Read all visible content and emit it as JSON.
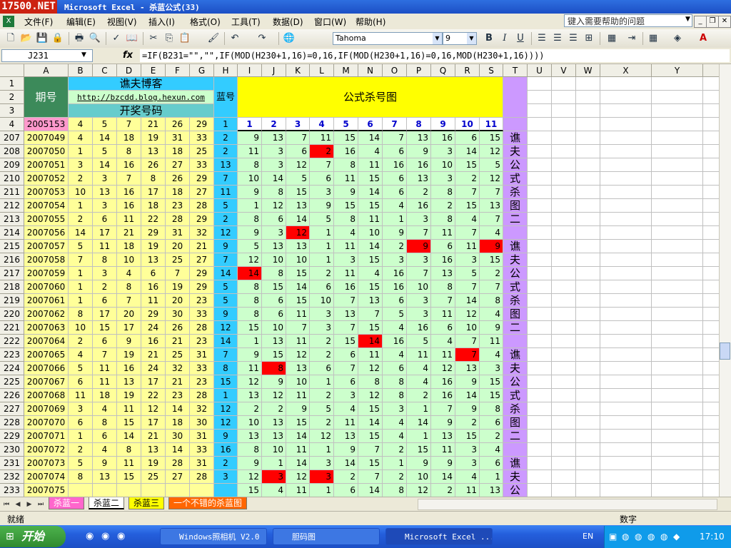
{
  "window": {
    "title": "Microsoft Excel - 杀蓝公式(33)",
    "logo": "17500.NET"
  },
  "menu": [
    "文件(F)",
    "编辑(E)",
    "视图(V)",
    "插入(I)",
    "格式(O)",
    "工具(T)",
    "数据(D)",
    "窗口(W)",
    "帮助(H)"
  ],
  "help_placeholder": "键入需要帮助的问题",
  "toolbar": {
    "font": "Tahoma",
    "size": "9"
  },
  "formula_bar": {
    "name_box": "J231",
    "fx": "fx",
    "formula": "=IF(B231=\"\",\"\",IF(MOD(H230+1,16)=0,16,IF(MOD(H230+1,16)=0,16,MOD(H230+1,16))))"
  },
  "columns": [
    "A",
    "B",
    "C",
    "D",
    "E",
    "F",
    "G",
    "H",
    "I",
    "J",
    "K",
    "L",
    "M",
    "N",
    "O",
    "P",
    "Q",
    "R",
    "S",
    "T",
    "U",
    "V",
    "W",
    "X",
    "Y",
    "Z"
  ],
  "header": {
    "period_label": "期号",
    "blog_label": "谯夫博客",
    "blog_url": "http://bzcdd.blog.hexun.com",
    "draw_label": "开奖号码",
    "blue_label": "蓝号",
    "chart_label": "公式杀号图",
    "header_row_nums": [
      "1",
      "2",
      "3",
      "4"
    ],
    "row4": {
      "period": "2005153",
      "nums": [
        "4",
        "5",
        "7",
        "21",
        "26",
        "29"
      ],
      "blue": "1"
    },
    "kill_headers": [
      "1",
      "2",
      "3",
      "4",
      "5",
      "6",
      "7",
      "8",
      "9",
      "10",
      "11"
    ]
  },
  "rows": [
    {
      "r": "207",
      "p": "2007049",
      "n": [
        "4",
        "14",
        "18",
        "19",
        "31",
        "33"
      ],
      "b": "2",
      "k": [
        "9",
        "13",
        "7",
        "11",
        "15",
        "14",
        "7",
        "13",
        "16",
        "6",
        "15"
      ]
    },
    {
      "r": "208",
      "p": "2007050",
      "n": [
        "1",
        "5",
        "8",
        "13",
        "18",
        "25"
      ],
      "b": "2",
      "k": [
        "11",
        "3",
        "6",
        "2",
        "16",
        "4",
        "6",
        "9",
        "3",
        "14",
        "12"
      ]
    },
    {
      "r": "209",
      "p": "2007051",
      "n": [
        "3",
        "14",
        "16",
        "26",
        "27",
        "33"
      ],
      "b": "13",
      "k": [
        "8",
        "3",
        "12",
        "7",
        "8",
        "11",
        "16",
        "16",
        "10",
        "15",
        "5"
      ]
    },
    {
      "r": "210",
      "p": "2007052",
      "n": [
        "2",
        "3",
        "7",
        "8",
        "26",
        "29"
      ],
      "b": "7",
      "k": [
        "10",
        "14",
        "5",
        "6",
        "11",
        "15",
        "6",
        "13",
        "3",
        "2",
        "12"
      ]
    },
    {
      "r": "211",
      "p": "2007053",
      "n": [
        "10",
        "13",
        "16",
        "17",
        "18",
        "27"
      ],
      "b": "11",
      "k": [
        "9",
        "8",
        "15",
        "3",
        "9",
        "14",
        "6",
        "2",
        "8",
        "7",
        "7"
      ]
    },
    {
      "r": "212",
      "p": "2007054",
      "n": [
        "1",
        "3",
        "16",
        "18",
        "23",
        "28"
      ],
      "b": "5",
      "k": [
        "1",
        "12",
        "13",
        "9",
        "15",
        "15",
        "4",
        "16",
        "2",
        "15",
        "13"
      ]
    },
    {
      "r": "213",
      "p": "2007055",
      "n": [
        "2",
        "6",
        "11",
        "22",
        "28",
        "29"
      ],
      "b": "2",
      "k": [
        "8",
        "6",
        "14",
        "5",
        "8",
        "11",
        "1",
        "3",
        "8",
        "4",
        "7"
      ]
    },
    {
      "r": "214",
      "p": "2007056",
      "n": [
        "14",
        "17",
        "21",
        "29",
        "31",
        "32"
      ],
      "b": "12",
      "k": [
        "9",
        "3",
        "12",
        "1",
        "4",
        "10",
        "9",
        "7",
        "11",
        "7",
        "4"
      ]
    },
    {
      "r": "215",
      "p": "2007057",
      "n": [
        "5",
        "11",
        "18",
        "19",
        "20",
        "21"
      ],
      "b": "9",
      "k": [
        "5",
        "13",
        "13",
        "1",
        "11",
        "14",
        "2",
        "9",
        "6",
        "11",
        "9"
      ]
    },
    {
      "r": "216",
      "p": "2007058",
      "n": [
        "7",
        "8",
        "10",
        "13",
        "25",
        "27"
      ],
      "b": "7",
      "k": [
        "12",
        "10",
        "10",
        "1",
        "3",
        "15",
        "3",
        "3",
        "16",
        "3",
        "15"
      ]
    },
    {
      "r": "217",
      "p": "2007059",
      "n": [
        "1",
        "3",
        "4",
        "6",
        "7",
        "29"
      ],
      "b": "14",
      "k": [
        "14",
        "8",
        "15",
        "2",
        "11",
        "4",
        "16",
        "7",
        "13",
        "5",
        "2"
      ]
    },
    {
      "r": "218",
      "p": "2007060",
      "n": [
        "1",
        "2",
        "8",
        "16",
        "19",
        "29"
      ],
      "b": "5",
      "k": [
        "8",
        "15",
        "14",
        "6",
        "16",
        "15",
        "16",
        "10",
        "8",
        "7",
        "7"
      ]
    },
    {
      "r": "219",
      "p": "2007061",
      "n": [
        "1",
        "6",
        "7",
        "11",
        "20",
        "23"
      ],
      "b": "5",
      "k": [
        "8",
        "6",
        "15",
        "10",
        "7",
        "13",
        "6",
        "3",
        "7",
        "14",
        "8"
      ]
    },
    {
      "r": "220",
      "p": "2007062",
      "n": [
        "8",
        "17",
        "20",
        "29",
        "30",
        "33"
      ],
      "b": "9",
      "k": [
        "8",
        "6",
        "11",
        "3",
        "13",
        "7",
        "5",
        "3",
        "11",
        "12",
        "4"
      ]
    },
    {
      "r": "221",
      "p": "2007063",
      "n": [
        "10",
        "15",
        "17",
        "24",
        "26",
        "28"
      ],
      "b": "12",
      "k": [
        "15",
        "10",
        "7",
        "3",
        "7",
        "15",
        "4",
        "16",
        "6",
        "10",
        "9"
      ]
    },
    {
      "r": "222",
      "p": "2007064",
      "n": [
        "2",
        "6",
        "9",
        "16",
        "21",
        "23"
      ],
      "b": "14",
      "k": [
        "1",
        "13",
        "11",
        "2",
        "15",
        "14",
        "16",
        "5",
        "4",
        "7",
        "11"
      ]
    },
    {
      "r": "223",
      "p": "2007065",
      "n": [
        "4",
        "7",
        "19",
        "21",
        "25",
        "31"
      ],
      "b": "7",
      "k": [
        "9",
        "15",
        "12",
        "2",
        "6",
        "11",
        "4",
        "11",
        "11",
        "7",
        "4"
      ]
    },
    {
      "r": "224",
      "p": "2007066",
      "n": [
        "5",
        "11",
        "16",
        "24",
        "32",
        "33"
      ],
      "b": "8",
      "k": [
        "11",
        "8",
        "13",
        "6",
        "7",
        "12",
        "6",
        "4",
        "12",
        "13",
        "3"
      ]
    },
    {
      "r": "225",
      "p": "2007067",
      "n": [
        "6",
        "11",
        "13",
        "17",
        "21",
        "23"
      ],
      "b": "15",
      "k": [
        "12",
        "9",
        "10",
        "1",
        "6",
        "8",
        "8",
        "4",
        "16",
        "9",
        "15"
      ]
    },
    {
      "r": "226",
      "p": "2007068",
      "n": [
        "11",
        "18",
        "19",
        "22",
        "23",
        "28"
      ],
      "b": "1",
      "k": [
        "13",
        "12",
        "11",
        "2",
        "3",
        "12",
        "8",
        "2",
        "16",
        "14",
        "15"
      ]
    },
    {
      "r": "227",
      "p": "2007069",
      "n": [
        "3",
        "4",
        "11",
        "12",
        "14",
        "32"
      ],
      "b": "12",
      "k": [
        "2",
        "2",
        "9",
        "5",
        "4",
        "15",
        "3",
        "1",
        "7",
        "9",
        "8"
      ]
    },
    {
      "r": "228",
      "p": "2007070",
      "n": [
        "6",
        "8",
        "15",
        "17",
        "18",
        "30"
      ],
      "b": "12",
      "k": [
        "10",
        "13",
        "15",
        "2",
        "11",
        "14",
        "4",
        "14",
        "9",
        "2",
        "6"
      ]
    },
    {
      "r": "229",
      "p": "2007071",
      "n": [
        "1",
        "6",
        "14",
        "21",
        "30",
        "31"
      ],
      "b": "9",
      "k": [
        "13",
        "13",
        "14",
        "12",
        "13",
        "15",
        "4",
        "1",
        "13",
        "15",
        "2"
      ]
    },
    {
      "r": "230",
      "p": "2007072",
      "n": [
        "2",
        "4",
        "8",
        "13",
        "14",
        "33"
      ],
      "b": "16",
      "k": [
        "8",
        "10",
        "11",
        "1",
        "9",
        "7",
        "2",
        "15",
        "11",
        "3",
        "4"
      ]
    },
    {
      "r": "231",
      "p": "2007073",
      "n": [
        "5",
        "9",
        "11",
        "19",
        "28",
        "31"
      ],
      "b": "2",
      "k": [
        "9",
        "1",
        "14",
        "3",
        "14",
        "15",
        "1",
        "9",
        "9",
        "3",
        "6"
      ]
    },
    {
      "r": "232",
      "p": "2007074",
      "n": [
        "8",
        "13",
        "15",
        "25",
        "27",
        "28"
      ],
      "b": "3",
      "k": [
        "12",
        "3",
        "12",
        "3",
        "2",
        "7",
        "2",
        "10",
        "14",
        "4",
        "1"
      ]
    },
    {
      "r": "233",
      "p": "2007075",
      "n": [
        "",
        "",
        "",
        "",
        "",
        ""
      ],
      "b": "",
      "k": [
        "15",
        "4",
        "11",
        "1",
        "6",
        "14",
        "8",
        "12",
        "2",
        "11",
        "13"
      ]
    }
  ],
  "red_cells": [
    [
      1,
      3
    ],
    [
      7,
      2
    ],
    [
      8,
      7
    ],
    [
      8,
      10
    ],
    [
      10,
      0
    ],
    [
      15,
      5
    ],
    [
      16,
      9
    ],
    [
      17,
      1
    ],
    [
      25,
      1
    ],
    [
      25,
      3
    ]
  ],
  "side_chars": [
    "谯",
    "夫",
    "公",
    "式",
    "杀",
    "图",
    "二",
    "",
    "谯",
    "夫",
    "公",
    "式",
    "杀",
    "图",
    "二",
    "",
    "谯",
    "夫",
    "公",
    "式",
    "杀",
    "图",
    "二",
    "",
    "谯",
    "夫",
    "公"
  ],
  "sheet_tabs": [
    "杀蓝一",
    "杀蓝二",
    "杀蓝三",
    "一个不错的杀蓝图"
  ],
  "status": {
    "left": "就绪",
    "right": "数字"
  },
  "taskbar": {
    "start": "开始",
    "items": [
      "Windows照相机 V2.0",
      "胆码图",
      "Microsoft Excel ..."
    ],
    "lang": "EN",
    "clock": "17:10"
  },
  "colors": {
    "yellow": "#ffff00",
    "cyan": "#33ccff",
    "green": "#3c8a5a",
    "teal": "#66cccc",
    "mint": "#ccffcc",
    "lilac": "#cc99ff",
    "red": "#ff0000",
    "pink": "#ff99cc",
    "pale": "#ffff99"
  }
}
